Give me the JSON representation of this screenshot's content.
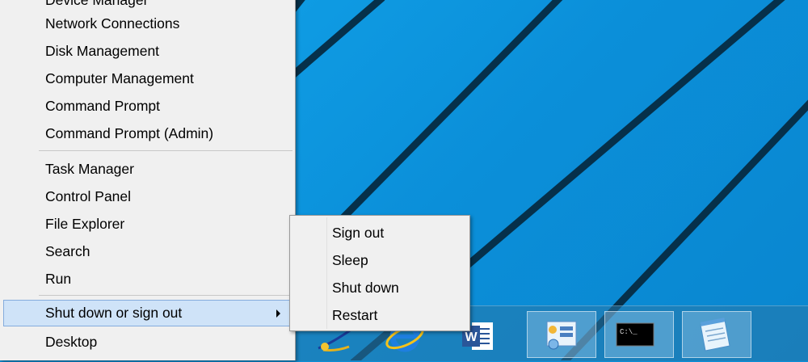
{
  "menu": {
    "items_top": [
      {
        "label": "Device Manager"
      },
      {
        "label": "Network Connections"
      },
      {
        "label": "Disk Management"
      },
      {
        "label": "Computer Management"
      },
      {
        "label": "Command Prompt"
      },
      {
        "label": "Command Prompt (Admin)"
      }
    ],
    "items_middle": [
      {
        "label": "Task Manager"
      },
      {
        "label": "Control Panel"
      },
      {
        "label": "File Explorer"
      },
      {
        "label": "Search"
      },
      {
        "label": "Run"
      }
    ],
    "shutdown": {
      "label": "Shut down or sign out",
      "icon": "chevron-right-icon"
    },
    "desktop": {
      "label": "Desktop"
    }
  },
  "submenu": {
    "items": [
      {
        "label": "Sign out"
      },
      {
        "label": "Sleep"
      },
      {
        "label": "Shut down"
      },
      {
        "label": "Restart"
      }
    ]
  },
  "taskbar": {
    "apps": [
      {
        "name": "Paint",
        "icon": "paint-brush-icon"
      },
      {
        "name": "Internet Explorer",
        "icon": "internet-explorer-icon"
      },
      {
        "name": "Word",
        "icon": "word-icon"
      },
      {
        "name": "Control Panel",
        "icon": "control-panel-icon"
      },
      {
        "name": "Command Prompt",
        "icon": "command-prompt-icon",
        "text": "C:\\_"
      },
      {
        "name": "Notepad",
        "icon": "notepad-icon"
      }
    ]
  },
  "colors": {
    "desktop": "#0b8fd9",
    "menu_bg": "#f0f0f0",
    "highlight": "#cfe3f8",
    "highlight_border": "#84acdd"
  }
}
